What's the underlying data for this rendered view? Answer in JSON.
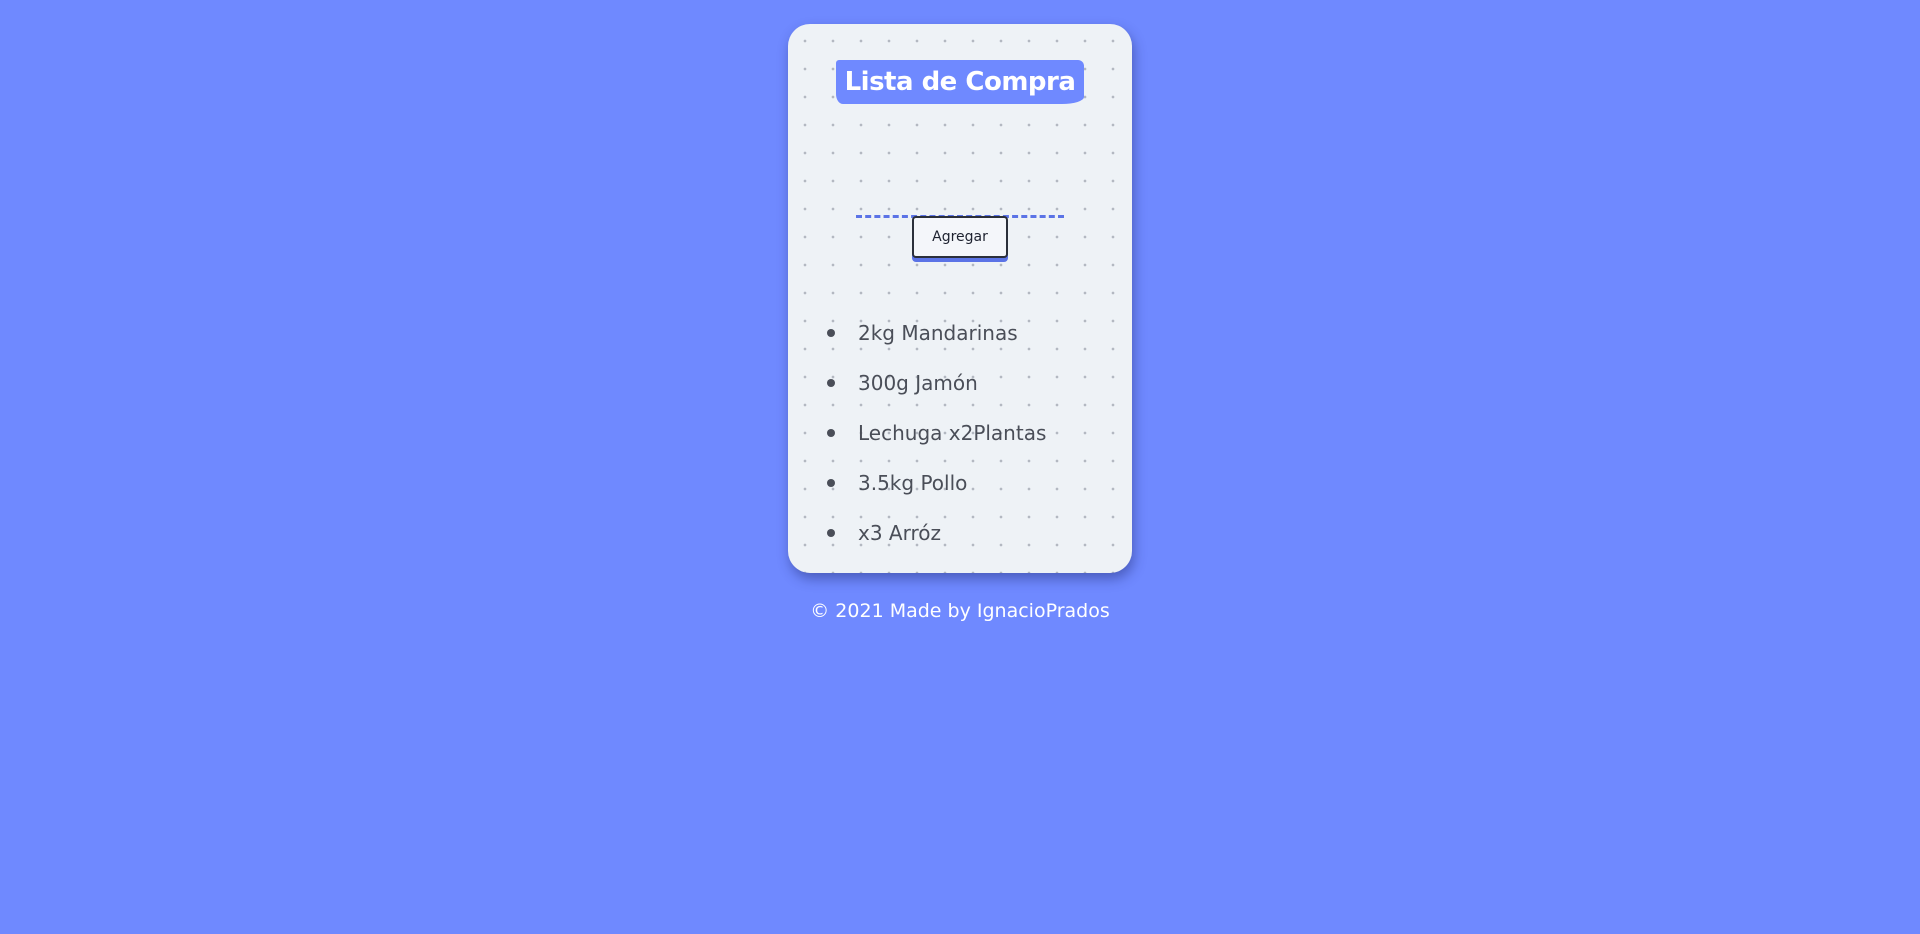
{
  "header": {
    "title": "Lista de Compra"
  },
  "form": {
    "input_value": "",
    "add_button_label": "Agregar"
  },
  "list": {
    "items": [
      {
        "label": "2kg Mandarinas"
      },
      {
        "label": "300g Jamón"
      },
      {
        "label": "Lechuga x2Plantas"
      },
      {
        "label": "3.5kg Pollo"
      },
      {
        "label": "x3 Arróz"
      }
    ]
  },
  "footer": {
    "text": "© 2021 Made by IgnacioPrados"
  },
  "colors": {
    "background": "#6f89ff",
    "card": "#eef2f6",
    "accent": "#5b73e6",
    "text": "#4a4e58"
  }
}
